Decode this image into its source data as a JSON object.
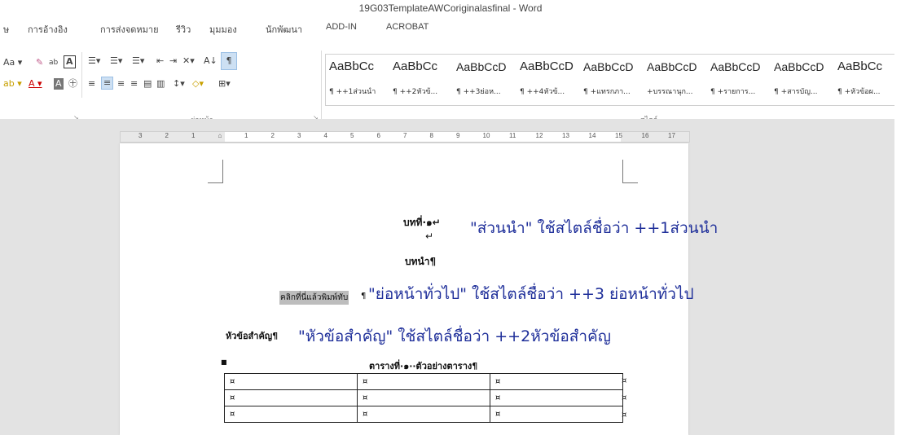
{
  "window": {
    "title": "19G03TemplateAWCoriginalasfinal - Word"
  },
  "tabs": [
    "ษ",
    "การอ้างอิง",
    "การส่งจดหมาย",
    "รีวิว",
    "มุมมอง",
    "นักพัฒนา",
    "ADD-IN",
    "ACROBAT"
  ],
  "ribbon": {
    "font_group": {
      "case_btn": "Aa ▾",
      "highlight_btn": "ab ▾",
      "font_color_btn": "A ▾"
    },
    "paragraph_group_label": "ย่อหน้า",
    "styles_group_label": "สไตล์",
    "show_marks_btn": "¶",
    "sort_btn": "A↓"
  },
  "styles_gallery": [
    {
      "preview": "AaBbCc",
      "name": "¶ ++1ส่วนนำ"
    },
    {
      "preview": "AaBbCc",
      "name": "¶ ++2หัวข้..."
    },
    {
      "preview": "AaBbCcD",
      "name": "¶ ++3ย่อห..."
    },
    {
      "preview": "AaBbCcD",
      "name": "¶ ++4หัวข้..."
    },
    {
      "preview": "AaBbCcD",
      "name": "¶ +แทรกภา..."
    },
    {
      "preview": "AaBbCcD",
      "name": "+บรรณานุก..."
    },
    {
      "preview": "AaBbCcD",
      "name": "¶ +รายการ..."
    },
    {
      "preview": "AaBbCcD",
      "name": "¶ +สารบัญ..."
    },
    {
      "preview": "AaBbCc",
      "name": "¶ +หัวข้อผ..."
    }
  ],
  "ruler": {
    "ticks": [
      "3",
      "2",
      "1",
      "",
      "1",
      "2",
      "3",
      "4",
      "5",
      "6",
      "7",
      "8",
      "9",
      "10",
      "11",
      "12",
      "13",
      "14",
      "15",
      "16",
      "17"
    ]
  },
  "document": {
    "chapter_heading": "บทที่·๑↵",
    "return_mark": "↵",
    "chapter_title": "บทนำ¶",
    "placeholder": "คลิกที่นี่แล้วพิมพ์ทับ",
    "placeholder_mark": "¶",
    "section_heading": "หัวข้อสำคัญ¶",
    "table_caption": "ตารางที่·๑··ตัวอย่างตาราง¶",
    "table_rows": [
      [
        "¤",
        "¤",
        "¤",
        "¤"
      ],
      [
        "¤",
        "¤",
        "¤",
        "¤"
      ],
      [
        "¤",
        "¤",
        "¤",
        "¤"
      ]
    ]
  },
  "annotations": {
    "a1": "\"ส่วนนำ\" ใช้สไตล์ชื่อว่า ++1ส่วนนำ",
    "a2": "\"ย่อหน้าทั่วไป\" ใช้สไตล์ชื่อว่า ++3 ย่อหน้าทั่วไป",
    "a3": "\"หัวข้อสำคัญ\" ใช้สไตล์ชื่อว่า ++2หัวข้อสำคัญ"
  },
  "colors": {
    "annotation": "#1f2f9a",
    "accent": "#2b579a"
  }
}
